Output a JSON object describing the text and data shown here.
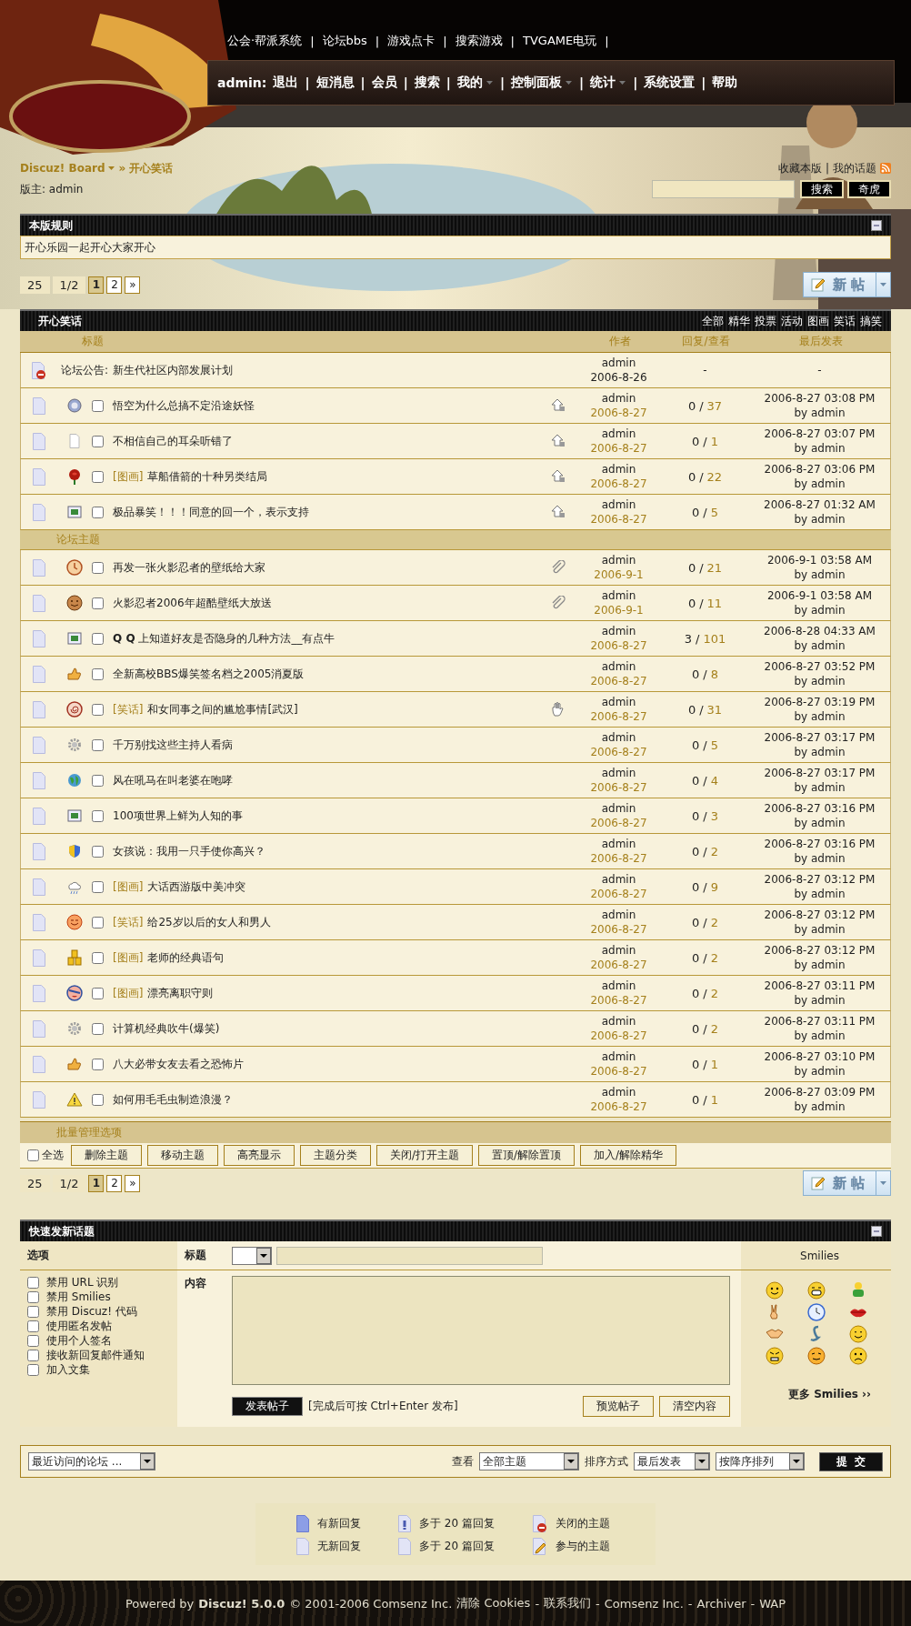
{
  "header": {
    "top_links": {
      "items": [
        "公会·帮派系统",
        "论坛bbs",
        "游戏点卡",
        "搜索游戏",
        "TVGAME电玩"
      ],
      "separator": "|"
    },
    "nav": {
      "user": "admin:",
      "separator": "|",
      "items": [
        {
          "label": "退出",
          "menu": false
        },
        {
          "label": "短消息",
          "menu": false
        },
        {
          "label": "会员",
          "menu": false
        },
        {
          "label": "搜索",
          "menu": false
        },
        {
          "label": "我的",
          "menu": true
        },
        {
          "label": "控制面板",
          "menu": true
        },
        {
          "label": "统计",
          "menu": true
        },
        {
          "label": "系统设置",
          "menu": false
        },
        {
          "label": "帮助",
          "menu": false
        }
      ]
    },
    "breadcrumb": {
      "root": "Discuz! Board",
      "separator": "»",
      "current": "开心笑话"
    },
    "moderator": "版主: admin",
    "links": {
      "items": [
        "收藏本版",
        "我的话题"
      ],
      "separator": "|"
    },
    "search_buttons": [
      "搜索",
      "奇虎"
    ],
    "rules": {
      "title": "本版规则",
      "text": "开心乐园一起开心大家开心"
    }
  },
  "pager_top": {
    "count": "25",
    "pages": "1/2",
    "items": [
      {
        "label": "1",
        "selected": true
      },
      {
        "label": "2",
        "selected": false
      },
      {
        "label": "»",
        "selected": false
      }
    ],
    "new_post": "新 帖"
  },
  "forum": {
    "title": "开心笑话",
    "filters": [
      "全部",
      "精华",
      "投票",
      "活动",
      "图画",
      "笑话",
      "搞笑"
    ],
    "columns": [
      "标题",
      "作者",
      "回复/查看",
      "最后发表"
    ],
    "reply_separator": "/",
    "announcement": {
      "label": "论坛公告:",
      "title": "新生代社区内部发展计划",
      "author": "admin",
      "date": "2006-8-26",
      "replies": "-",
      "last": "-"
    },
    "sticky": [
      {
        "title": "悟空为什么总搞不定沿途妖怪",
        "marker": {
          "kind": "arrow"
        },
        "checked": false,
        "author": "admin",
        "date": "2006-8-27",
        "replies": "0",
        "views": "37",
        "last_time": "2006-8-27 03:08 PM",
        "last_by": "by admin"
      },
      {
        "title": "不相信自己的耳朵听错了",
        "marker": {
          "kind": "arrow"
        },
        "checked": false,
        "author": "admin",
        "date": "2006-8-27",
        "replies": "0",
        "views": "1",
        "last_time": "2006-8-27 03:07 PM",
        "last_by": "by admin"
      },
      {
        "tag": "[图画]",
        "title": "草船借箭的十种另类结局",
        "marker": {
          "kind": "arrow"
        },
        "checked": false,
        "author": "admin",
        "date": "2006-8-27",
        "replies": "0",
        "views": "22",
        "last_time": "2006-8-27 03:06 PM",
        "last_by": "by admin"
      },
      {
        "title": "极品暴笑！！！同意的回一个，表示支持",
        "marker": {
          "kind": "arrow"
        },
        "checked": false,
        "author": "admin",
        "date": "2006-8-27",
        "replies": "0",
        "views": "5",
        "last_time": "2006-8-27 01:32 AM",
        "last_by": "by admin"
      }
    ],
    "section_title": "论坛主题",
    "topics": [
      {
        "title": "再发一张火影忍者的壁纸给大家",
        "marker": {
          "kind": "clip"
        },
        "checked": false,
        "author": "admin",
        "date": "2006-9-1",
        "replies": "0",
        "views": "21",
        "last_time": "2006-9-1 03:58 AM",
        "last_by": "by admin"
      },
      {
        "title": "火影忍者2006年超酷壁纸大放送",
        "marker": {
          "kind": "clip"
        },
        "checked": false,
        "author": "admin",
        "date": "2006-9-1",
        "replies": "0",
        "views": "11",
        "last_time": "2006-9-1 03:58 AM",
        "last_by": "by admin"
      },
      {
        "title": "**Q Q** 上知道好友是否隐身的几种方法__有点牛",
        "checked": false,
        "author": "admin",
        "date": "2006-8-27",
        "replies": "3",
        "views": "101",
        "last_time": "2006-8-28 04:33 AM",
        "last_by": "by admin"
      },
      {
        "title": "全新高校BBS爆笑签名档之2005消夏版",
        "checked": false,
        "author": "admin",
        "date": "2006-8-27",
        "replies": "0",
        "views": "8",
        "last_time": "2006-8-27 03:52 PM",
        "last_by": "by admin"
      },
      {
        "tag": "[笑话]",
        "title": "和女同事之间的尴尬事情[武汉]",
        "marker": {
          "kind": "hand"
        },
        "checked": false,
        "author": "admin",
        "date": "2006-8-27",
        "replies": "0",
        "views": "31",
        "last_time": "2006-8-27 03:19 PM",
        "last_by": "by admin"
      },
      {
        "title": "千万别找这些主持人看病",
        "checked": false,
        "author": "admin",
        "date": "2006-8-27",
        "replies": "0",
        "views": "5",
        "last_time": "2006-8-27 03:17 PM",
        "last_by": "by admin"
      },
      {
        "title": "风在吼马在叫老婆在咆哮",
        "checked": false,
        "author": "admin",
        "date": "2006-8-27",
        "replies": "0",
        "views": "4",
        "last_time": "2006-8-27 03:17 PM",
        "last_by": "by admin"
      },
      {
        "title": "100项世界上鲜为人知的事",
        "checked": false,
        "author": "admin",
        "date": "2006-8-27",
        "replies": "0",
        "views": "3",
        "last_time": "2006-8-27 03:16 PM",
        "last_by": "by admin"
      },
      {
        "title": "女孩说：我用一只手使你高兴？",
        "checked": false,
        "author": "admin",
        "date": "2006-8-27",
        "replies": "0",
        "views": "2",
        "last_time": "2006-8-27 03:16 PM",
        "last_by": "by admin"
      },
      {
        "tag": "[图画]",
        "title": "大话西游版中美冲突",
        "checked": false,
        "author": "admin",
        "date": "2006-8-27",
        "replies": "0",
        "views": "9",
        "last_time": "2006-8-27 03:12 PM",
        "last_by": "by admin"
      },
      {
        "tag": "[笑话]",
        "title": "给25岁以后的女人和男人",
        "checked": false,
        "author": "admin",
        "date": "2006-8-27",
        "replies": "0",
        "views": "2",
        "last_time": "2006-8-27 03:12 PM",
        "last_by": "by admin"
      },
      {
        "tag": "[图画]",
        "title": "老师的经典语句",
        "checked": false,
        "author": "admin",
        "date": "2006-8-27",
        "replies": "0",
        "views": "2",
        "last_time": "2006-8-27 03:12 PM",
        "last_by": "by admin"
      },
      {
        "tag": "[图画]",
        "title": "漂亮离职守则",
        "checked": false,
        "author": "admin",
        "date": "2006-8-27",
        "replies": "0",
        "views": "2",
        "last_time": "2006-8-27 03:11 PM",
        "last_by": "by admin"
      },
      {
        "title": "计算机经典吹牛(爆笑)",
        "checked": false,
        "author": "admin",
        "date": "2006-8-27",
        "replies": "0",
        "views": "2",
        "last_time": "2006-8-27 03:11 PM",
        "last_by": "by admin"
      },
      {
        "title": "八大必带女友去看之恐怖片",
        "checked": false,
        "author": "admin",
        "date": "2006-8-27",
        "replies": "0",
        "views": "1",
        "last_time": "2006-8-27 03:10 PM",
        "last_by": "by admin"
      },
      {
        "title": "如何用毛毛虫制造浪漫？",
        "checked": false,
        "author": "admin",
        "date": "2006-8-27",
        "replies": "0",
        "views": "1",
        "last_time": "2006-8-27 03:09 PM",
        "last_by": "by admin"
      }
    ]
  },
  "batch": {
    "title": "批量管理选项",
    "select_all": {
      "label": "全选",
      "checked": false
    },
    "buttons": [
      "删除主题",
      "移动主题",
      "高亮显示",
      "主题分类",
      "关闭/打开主题",
      "置顶/解除置顶",
      "加入/解除精华"
    ]
  },
  "pager_bottom": {
    "count": "25",
    "pages": "1/2",
    "items": [
      {
        "label": "1",
        "selected": true
      },
      {
        "label": "2",
        "selected": false
      },
      {
        "label": "»",
        "selected": false
      }
    ],
    "new_post": "新 帖"
  },
  "quick_post": {
    "title": "快速发新话题",
    "options_label": "选项",
    "subject_label": "标题",
    "content_label": "内容",
    "smilies_label": "Smilies",
    "options": [
      {
        "label": "禁用 URL 识别",
        "checked": false
      },
      {
        "label": "禁用 Smilies",
        "checked": false
      },
      {
        "label": "禁用 Discuz! 代码",
        "checked": false
      },
      {
        "label": "使用匿名发帖",
        "checked": false
      },
      {
        "label": "使用个人签名",
        "checked": false
      },
      {
        "label": "接收新回复邮件通知",
        "checked": false
      },
      {
        "label": "加入文集",
        "checked": false
      }
    ],
    "submit": "发表帖子",
    "hint": "[完成后可按 Ctrl+Enter 发布]",
    "preview": "预览帖子",
    "clear": "清空内容",
    "more_smilies": "更多 Smilies ››"
  },
  "filter_bar": {
    "jump": "最近访问的论坛 ...",
    "view_label": "查看",
    "view": "全部主题",
    "sort_label": "排序方式",
    "sort": "最后发表",
    "order": "按降序排列",
    "submit": "提  交"
  },
  "legend": [
    "有新回复",
    "多于 20 篇回复",
    "关闭的主题",
    "无新回复",
    "多于 20 篇回复",
    "参与的主题"
  ],
  "footer": {
    "powered": "Powered by",
    "brand": "Discuz! 5.0.0",
    "copyright": "© 2001-2006 Comsenz Inc.",
    "links": [
      "清除 Cookies",
      "联系我们",
      "Comsenz Inc.",
      "Archiver",
      "WAP"
    ],
    "separator": "-"
  }
}
